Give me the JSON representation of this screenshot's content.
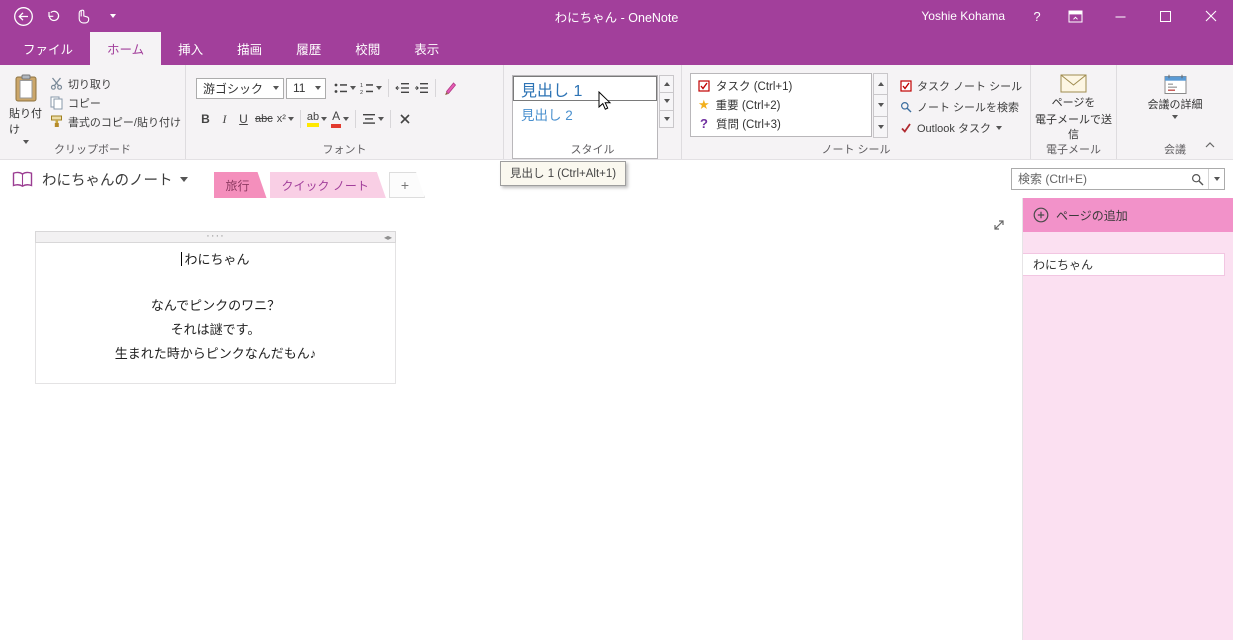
{
  "colors": {
    "titlebar_purple": "#A23F9B",
    "ribbon_bg": "#F5F3F5",
    "section_tab_pink": "#F48FBC",
    "active_section_pink": "#F9CFE5",
    "panel_header_pink": "#F292C9",
    "panel_body_pink": "#FBE0F1",
    "heading_blue": "#2E74B5"
  },
  "titlebar": {
    "title": "わにちゃん - OneNote",
    "user": "Yoshie Kohama",
    "help": "?"
  },
  "ribbon_tabs": {
    "file": "ファイル",
    "home": "ホーム",
    "insert": "挿入",
    "draw": "描画",
    "history": "履歴",
    "review": "校閲",
    "view": "表示"
  },
  "clipboard": {
    "label": "クリップボード",
    "paste": "貼り付け",
    "cut": "切り取り",
    "copy": "コピー",
    "format_painter": "書式のコピー/貼り付け"
  },
  "font": {
    "label": "フォント",
    "font_name": "游ゴシック",
    "font_size": "11",
    "bold": "B",
    "italic": "I",
    "underline": "U",
    "strikethrough": "abc",
    "superscript": "x²",
    "highlight": "ab",
    "font_color": "A"
  },
  "styles": {
    "label": "スタイル",
    "heading1": "見出し 1",
    "heading2": "見出し 2"
  },
  "tags": {
    "label": "ノート シール",
    "task": "タスク (Ctrl+1)",
    "important": "重要 (Ctrl+2)",
    "question": "質問 (Ctrl+3)",
    "task_tag": "タスク ノート シール",
    "find_tags": "ノート シールを検索",
    "outlook_tasks": "Outlook タスク"
  },
  "email": {
    "label": "電子メール",
    "send_line1": "ページを",
    "send_line2": "電子メールで送信"
  },
  "meeting": {
    "label": "会議",
    "details": "会議の詳細"
  },
  "tooltip": {
    "text": "見出し 1 (Ctrl+Alt+1)"
  },
  "navbar": {
    "notebook": "わにちゃんのノート",
    "sections": [
      "旅行",
      "クイック ノート"
    ],
    "add_section": "+",
    "search_placeholder": "検索 (Ctrl+E)"
  },
  "page_panel": {
    "add_page": "ページの追加",
    "pages": [
      "わにちゃん"
    ]
  },
  "note": {
    "title": "わにちゃん",
    "lines": [
      "なんでピンクのワニ？",
      "それは謎です。",
      "生まれた時からピンクなんだもん♪"
    ]
  },
  "icons": {
    "star": "★",
    "question_mark": "?",
    "handle_dots": "····",
    "resize_arrows": "◂▸"
  }
}
